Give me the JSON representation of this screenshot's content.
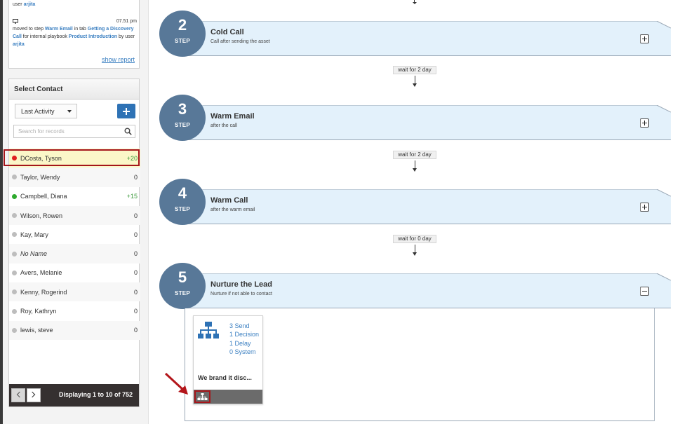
{
  "activity": {
    "line1_prefix": "user",
    "line1_user": "arjita",
    "time": "07.51 pm",
    "text_moved": "moved to step",
    "step_name": "Warm Email",
    "text_in_tab": "in tab",
    "tab_name": "Getting a Discovery Call",
    "text_for": "for internal playbook",
    "playbook": "Product Introduction",
    "text_by": "by user",
    "user": "arjita",
    "show_report": "show report"
  },
  "contacts": {
    "title": "Select Contact",
    "sort_value": "Last Activity",
    "search_placeholder": "Search for records",
    "items": [
      {
        "name": "DCosta, Tyson",
        "score": "+20",
        "status": "red"
      },
      {
        "name": "Taylor, Wendy",
        "score": "0",
        "status": "gray"
      },
      {
        "name": "Campbell, Diana",
        "score": "+15",
        "status": "green"
      },
      {
        "name": "Wilson, Rowen",
        "score": "0",
        "status": "gray"
      },
      {
        "name": "Kay, Mary",
        "score": "0",
        "status": "gray"
      },
      {
        "name": "No Name",
        "score": "0",
        "status": "gray"
      },
      {
        "name": "Avers, Melanie",
        "score": "0",
        "status": "gray"
      },
      {
        "name": "Kenny, Rogerind",
        "score": "0",
        "status": "gray"
      },
      {
        "name": "Roy, Kathryn",
        "score": "0",
        "status": "gray"
      },
      {
        "name": "lewis, steve",
        "score": "0",
        "status": "gray"
      }
    ],
    "pager_text": "Displaying 1 to 10 of 752"
  },
  "steps": [
    {
      "number": "2",
      "label": "STEP",
      "title": "Cold Call",
      "subtitle": "Call after sending the asset"
    },
    {
      "number": "3",
      "label": "STEP",
      "title": "Warm Email",
      "subtitle": "after the call"
    },
    {
      "number": "4",
      "label": "STEP",
      "title": "Warm Call",
      "subtitle": "after the warm email"
    },
    {
      "number": "5",
      "label": "STEP",
      "title": "Nurture the Lead",
      "subtitle": "Nurture if not able to contact"
    }
  ],
  "waits": [
    "wait for 2 day",
    "wait for 2 day",
    "wait for 0 day"
  ],
  "card": {
    "stats": [
      "3 Send",
      "1 Decision",
      "1 Delay",
      "0 System"
    ],
    "title": "We brand it disc..."
  },
  "colors": {
    "step_circle": "#587898",
    "banner": "#e3f1fb",
    "link": "#3a7fc1",
    "highlight": "#a5161b"
  }
}
